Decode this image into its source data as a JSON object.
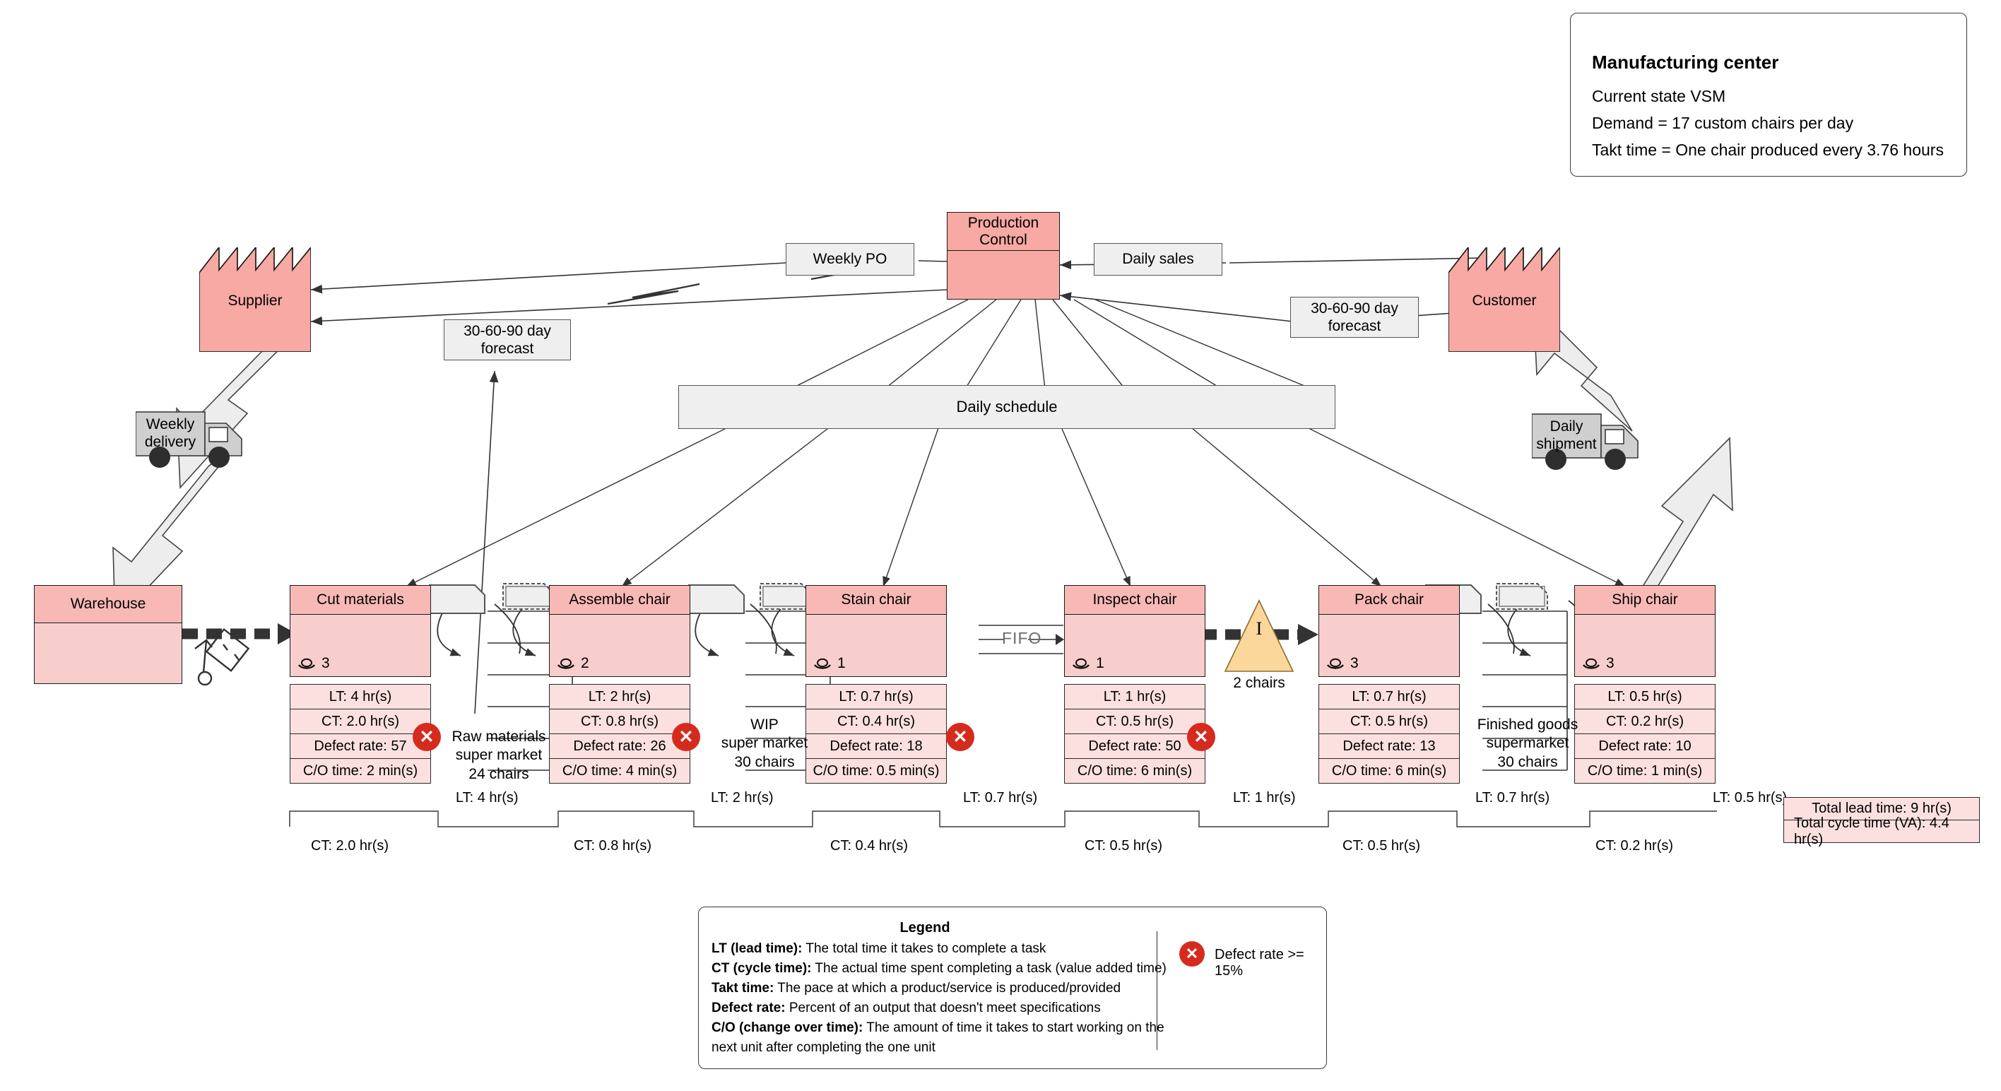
{
  "title_card": {
    "heading": "Manufacturing center",
    "lines": [
      "Current state VSM",
      "Demand = 17 custom chairs per day",
      "Takt time = One chair produced every 3.76 hours"
    ]
  },
  "control": {
    "label": "Production\nControl",
    "label_line1": "Production",
    "label_line2": "Control",
    "color": "#F8A9A4"
  },
  "external": {
    "supplier": "Supplier",
    "customer": "Customer",
    "warehouse": "Warehouse",
    "weekly_po": "Weekly PO",
    "daily_sales": "Daily sales",
    "forecast_left": "30-60-90 day\nforecast",
    "forecast_left_l1": "30-60-90 day",
    "forecast_left_l2": "forecast",
    "forecast_right_l1": "30-60-90 day",
    "forecast_right_l2": "forecast",
    "daily_schedule": "Daily schedule",
    "weekly_delivery_l1": "Weekly",
    "weekly_delivery_l2": "delivery",
    "daily_shipment_l1": "Daily",
    "daily_shipment_l2": "shipment"
  },
  "processes": [
    {
      "name": "Cut materials",
      "operators": "3",
      "lt": "LT: 4 hr(s)",
      "ct": "CT: 2.0 hr(s)",
      "defect": "Defect rate: 57",
      "co": "C/O time: 2 min(s)",
      "flag": true
    },
    {
      "name": "Assemble chair",
      "operators": "2",
      "lt": "LT: 2 hr(s)",
      "ct": "CT: 0.8 hr(s)",
      "defect": "Defect rate: 26",
      "co": "C/O time: 4 min(s)",
      "flag": true
    },
    {
      "name": "Stain chair",
      "operators": "1",
      "lt": "LT: 0.7 hr(s)",
      "ct": "CT: 0.4 hr(s)",
      "defect": "Defect rate: 18",
      "co": "C/O time: 0.5 min(s)",
      "flag": true
    },
    {
      "name": "Inspect chair",
      "operators": "1",
      "lt": "LT: 1 hr(s)",
      "ct": "CT: 0.5 hr(s)",
      "defect": "Defect rate: 50",
      "co": "C/O time: 6 min(s)",
      "flag": true
    },
    {
      "name": "Pack chair",
      "operators": "3",
      "lt": "LT: 0.7 hr(s)",
      "ct": "CT: 0.5 hr(s)",
      "defect": "Defect rate: 13",
      "co": "C/O time: 6 min(s)",
      "flag": false
    },
    {
      "name": "Ship chair",
      "operators": "3",
      "lt": "LT: 0.5 hr(s)",
      "ct": "CT: 0.2 hr(s)",
      "defect": "Defect rate: 10",
      "co": "C/O time: 1 min(s)",
      "flag": false
    }
  ],
  "supermarkets": [
    {
      "id": "raw",
      "l1": "Raw materials",
      "l2": "super market",
      "l3": "24 chairs"
    },
    {
      "id": "wip",
      "l1": "WIP",
      "l2": "super market",
      "l3": "30 chairs"
    },
    {
      "id": "finished",
      "l1": "Finished goods",
      "l2": "supermarket",
      "l3": "30 chairs"
    }
  ],
  "fifo": {
    "label": "FIFO"
  },
  "inventory_triangle": {
    "symbol": "I",
    "label": "2 chairs"
  },
  "timeline": {
    "lt": [
      "LT: 4 hr(s)",
      "LT: 2 hr(s)",
      "LT: 0.7 hr(s)",
      "LT: 1 hr(s)",
      "LT: 0.7 hr(s)",
      "LT: 0.5 hr(s)"
    ],
    "ct": [
      "CT: 2.0 hr(s)",
      "CT: 0.8 hr(s)",
      "CT: 0.4 hr(s)",
      "CT: 0.5 hr(s)",
      "CT: 0.5 hr(s)",
      "CT: 0.2 hr(s)"
    ],
    "total_lead": "Total lead time: 9 hr(s)",
    "total_cycle": "Total cycle time (VA): 4.4 hr(s)"
  },
  "legend": {
    "title": "Legend",
    "items": [
      {
        "term": "LT (lead time):",
        "desc": " The total time it takes to complete a task"
      },
      {
        "term": "CT (cycle time):",
        "desc": " The actual time spent completing a task (value added time)"
      },
      {
        "term": "Takt time:",
        "desc": " The pace at which a product/service is produced/provided"
      },
      {
        "term": "Defect rate:",
        "desc": " Percent of an output that doesn't meet specifications"
      },
      {
        "term": "C/O (change over time):",
        "desc": " The amount of time it takes to start working on the"
      }
    ],
    "last_line": "next unit after completing the one unit",
    "flag_note": "Defect rate >= 15%"
  },
  "colors": {
    "process_fill": "#F8CECC",
    "process_head": "#F8B9B6",
    "control_fill": "#F8A9A4",
    "info_fill": "#EFEFEF",
    "defect_red": "#D52B1E",
    "triangle_fill": "#FBD79B"
  }
}
